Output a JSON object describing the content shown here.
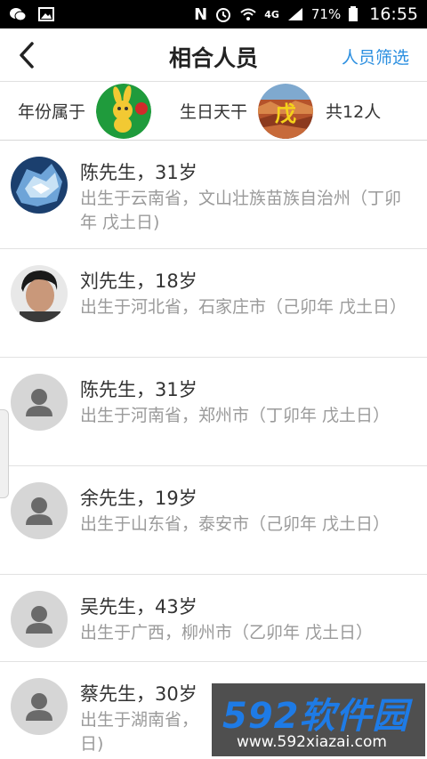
{
  "status_bar": {
    "network": "4G",
    "battery": "71%",
    "time": "16:55",
    "icons": [
      "wechat-icon",
      "gallery-icon",
      "n-icon",
      "alarm-icon",
      "wifi-icon",
      "signal-icon",
      "battery-icon"
    ]
  },
  "header": {
    "title": "相合人员",
    "filter_label": "人员筛选",
    "back_icon": "chevron-left-icon"
  },
  "info_bar": {
    "year_label": "年份属于",
    "stem_label": "生日天干",
    "stem_char": "戊",
    "total": "共12人"
  },
  "people": [
    {
      "name": "陈先生，31岁",
      "desc": "出生于云南省，文山壮族苗族自治州（丁卯年 戊土日)",
      "avatar": "photo-ice"
    },
    {
      "name": "刘先生，18岁",
      "desc": "出生于河北省，石家庄市（己卯年 戊土日）",
      "avatar": "photo-person"
    },
    {
      "name": "陈先生，31岁",
      "desc": "出生于河南省，郑州市（丁卯年 戊土日）",
      "avatar": "generic"
    },
    {
      "name": "余先生，19岁",
      "desc": "出生于山东省，泰安市（己卯年 戊土日）",
      "avatar": "generic"
    },
    {
      "name": "吴先生，43岁",
      "desc": "出生于广西，柳州市（乙卯年 戊土日）",
      "avatar": "generic"
    },
    {
      "name": "蔡先生，30岁",
      "desc": "出生于湖南省，",
      "desc2": "日)",
      "avatar": "generic"
    }
  ],
  "watermark": {
    "logo": "592软件园",
    "site": "www.592xiazai.com"
  },
  "colors": {
    "accent": "#2b8fe0",
    "status_bar_bg": "#000000",
    "divider": "#e2e2e2",
    "secondary_text": "#9a9a9a"
  }
}
